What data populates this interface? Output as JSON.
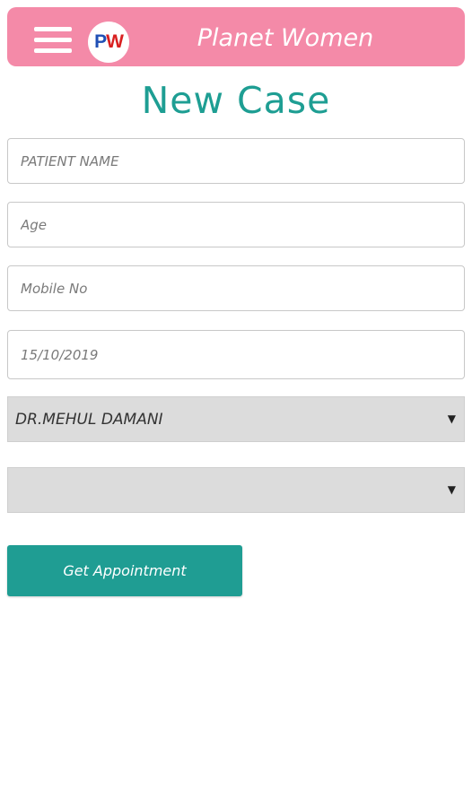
{
  "header": {
    "logo_text_p": "P",
    "logo_text_w": "W",
    "app_title": "Planet Women",
    "colors": {
      "header_bg": "#f48aa8",
      "accent": "#1e9e93"
    },
    "menu_icon": "hamburger-menu-icon"
  },
  "page": {
    "title": "New Case"
  },
  "form": {
    "patient_name_placeholder": "PATIENT NAME",
    "age_placeholder": "Age",
    "mobile_placeholder": "Mobile No",
    "date_value": "15/10/2019",
    "doctor_select_value": "DR.MEHUL DAMANI",
    "second_select_value": "",
    "dropdown_arrow": "▼",
    "submit_label": "Get Appointment"
  }
}
